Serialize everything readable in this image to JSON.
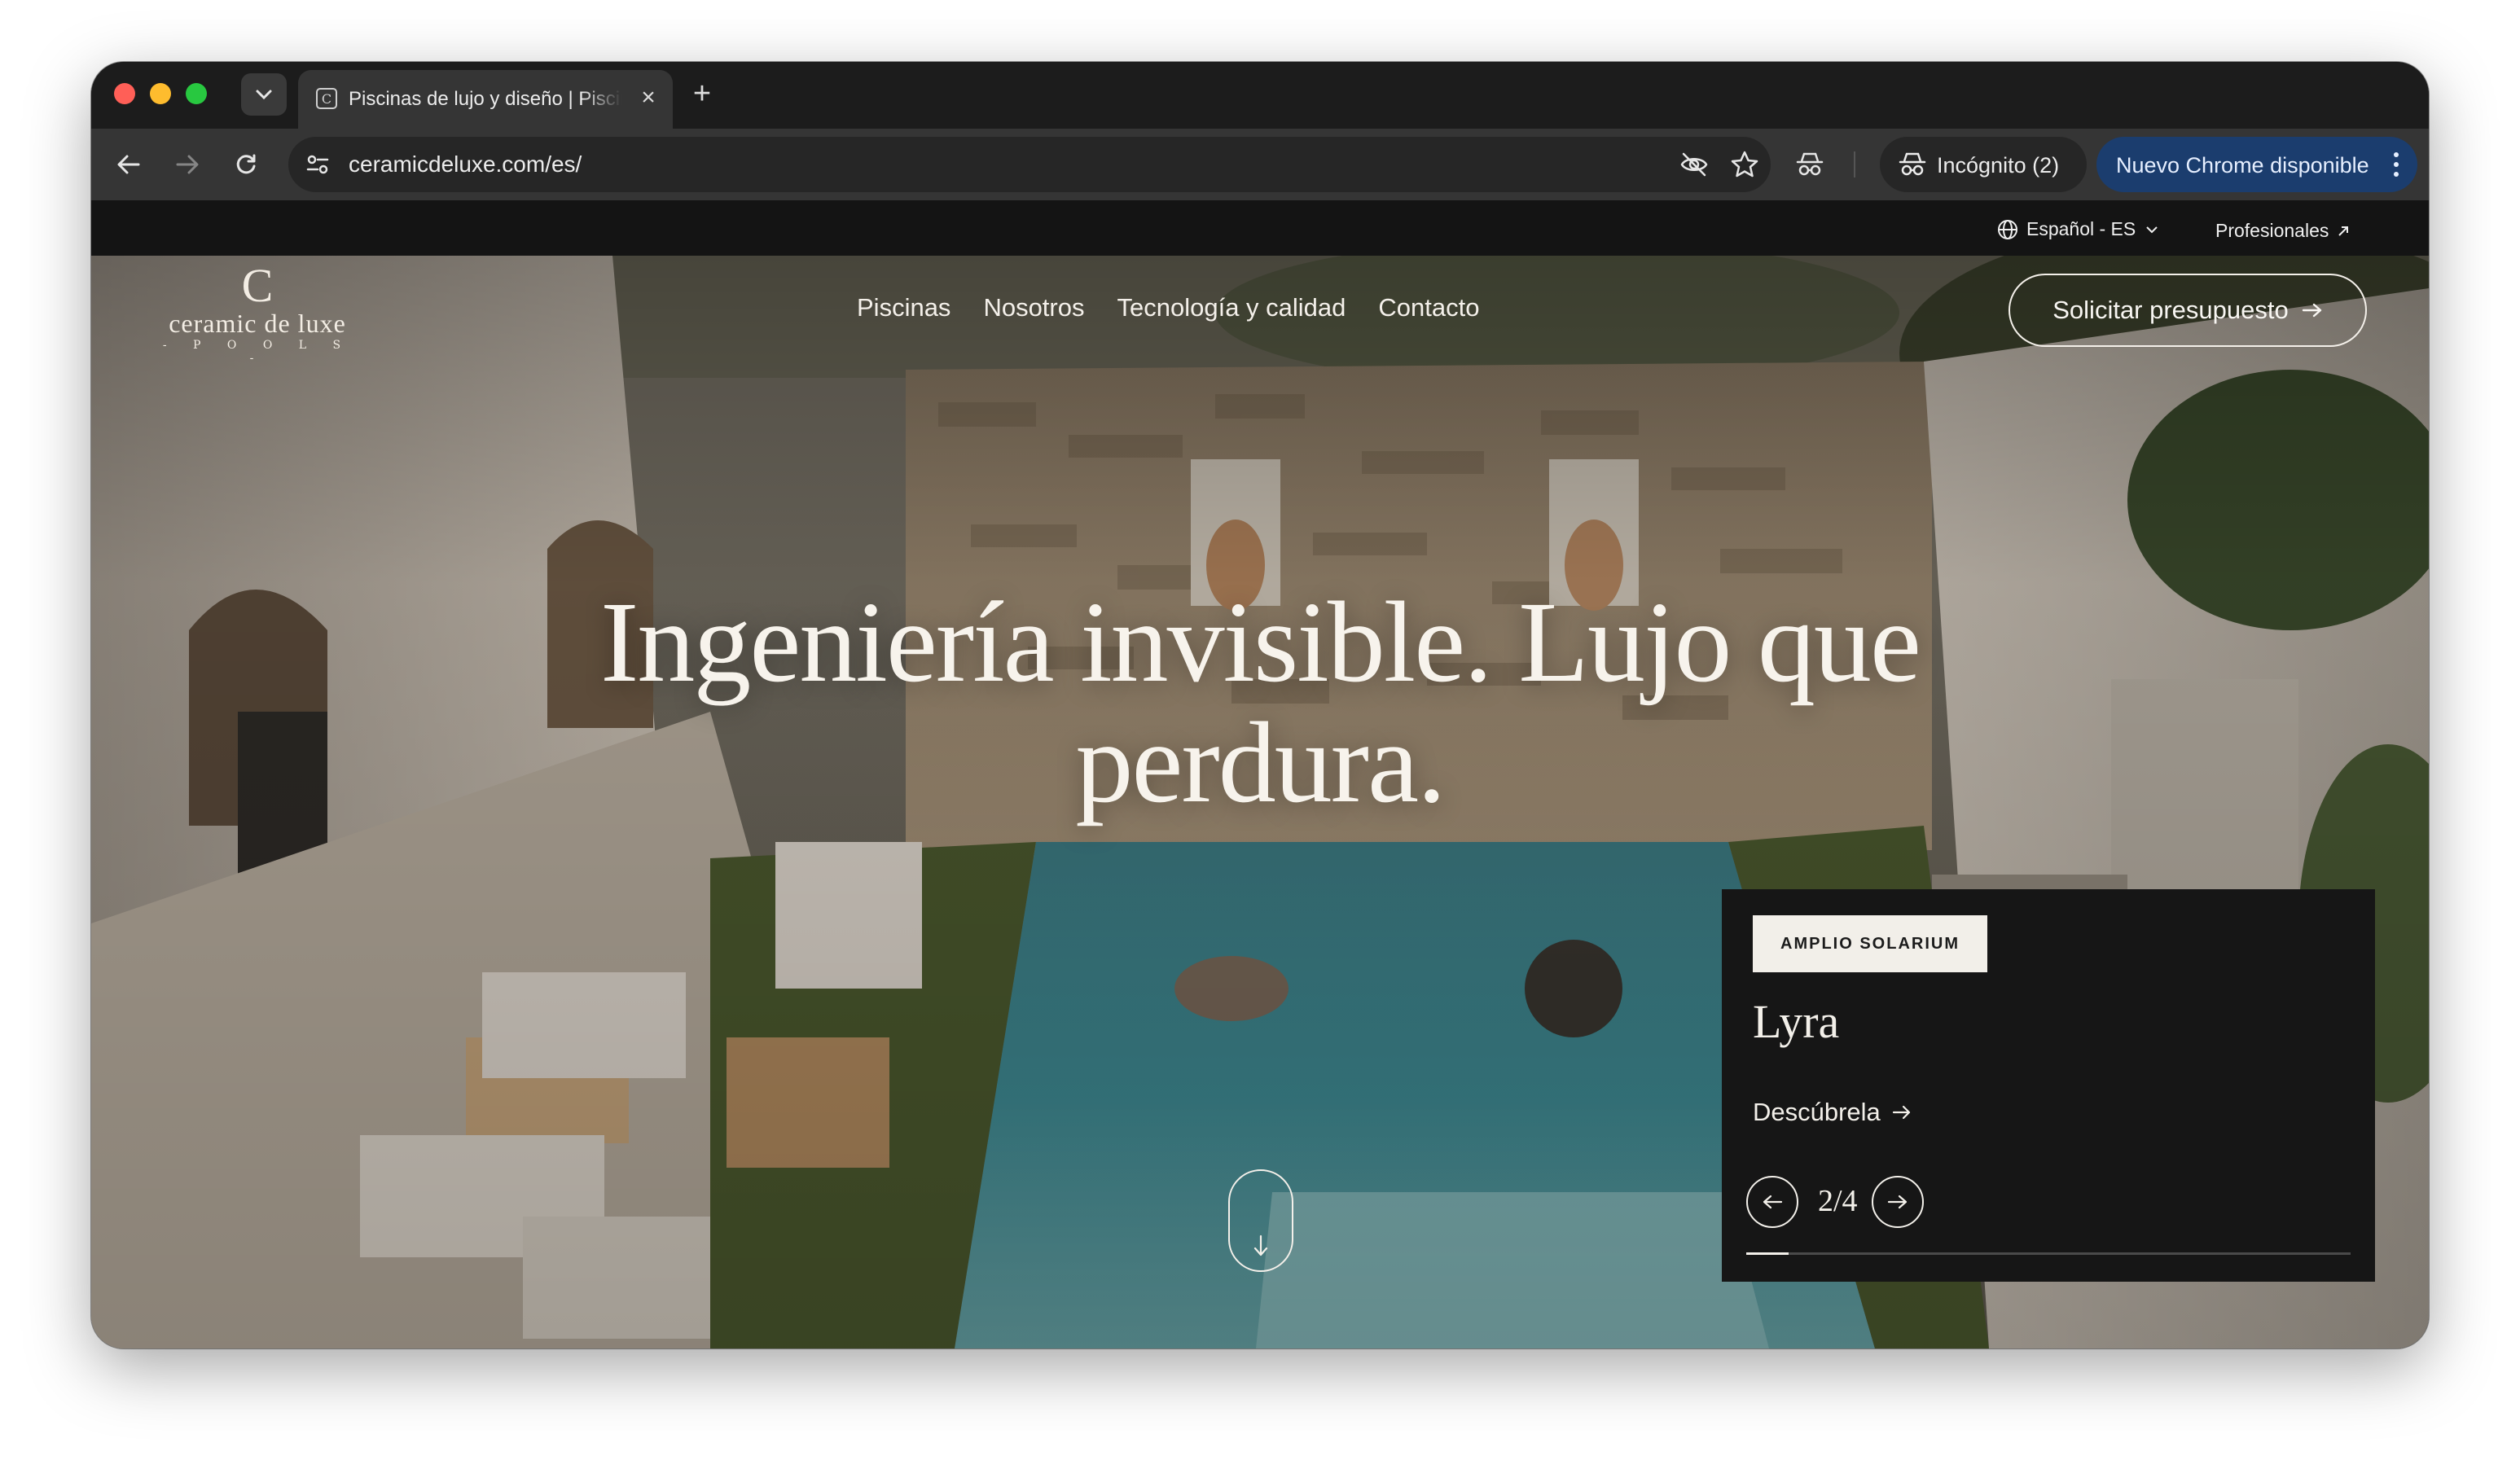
{
  "browser": {
    "tab": {
      "title": "Piscinas de lujo y diseño | Piscinas de lujo",
      "favicon_icon": "ceramic-de-luxe-favicon-icon"
    },
    "address_bar": {
      "url": "ceramicdeluxe.com/es/"
    },
    "incognito": {
      "label": "Incógnito (2)"
    },
    "update_button": {
      "label": "Nuevo Chrome disponible"
    }
  },
  "site": {
    "utility_bar": {
      "language": "Español - ES",
      "professionals": "Profesionales"
    },
    "logo": {
      "mark": "C",
      "wordmark": "ceramic de luxe",
      "sub": "- P O O L S -"
    },
    "nav": {
      "items": [
        "Piscinas",
        "Nosotros",
        "Tecnología y calidad",
        "Contacto"
      ]
    },
    "cta": {
      "label": "Solicitar presupuesto"
    },
    "hero": {
      "headline": "Ingeniería invisible. Lujo que perdura.",
      "photo_description_icon": "pool-courtyard-photo"
    },
    "card": {
      "tag": "AMPLIO SOLARIUM",
      "title": "Lyra",
      "link": "Descúbrela",
      "counter": "2/4",
      "progress": 0.07
    }
  },
  "colors": {
    "chrome_dark": "#1c1c1c",
    "toolbar": "#353535",
    "update_blue": "#1b3d6e",
    "site_text": "#f4f0ea",
    "card_bg": "#161616"
  }
}
